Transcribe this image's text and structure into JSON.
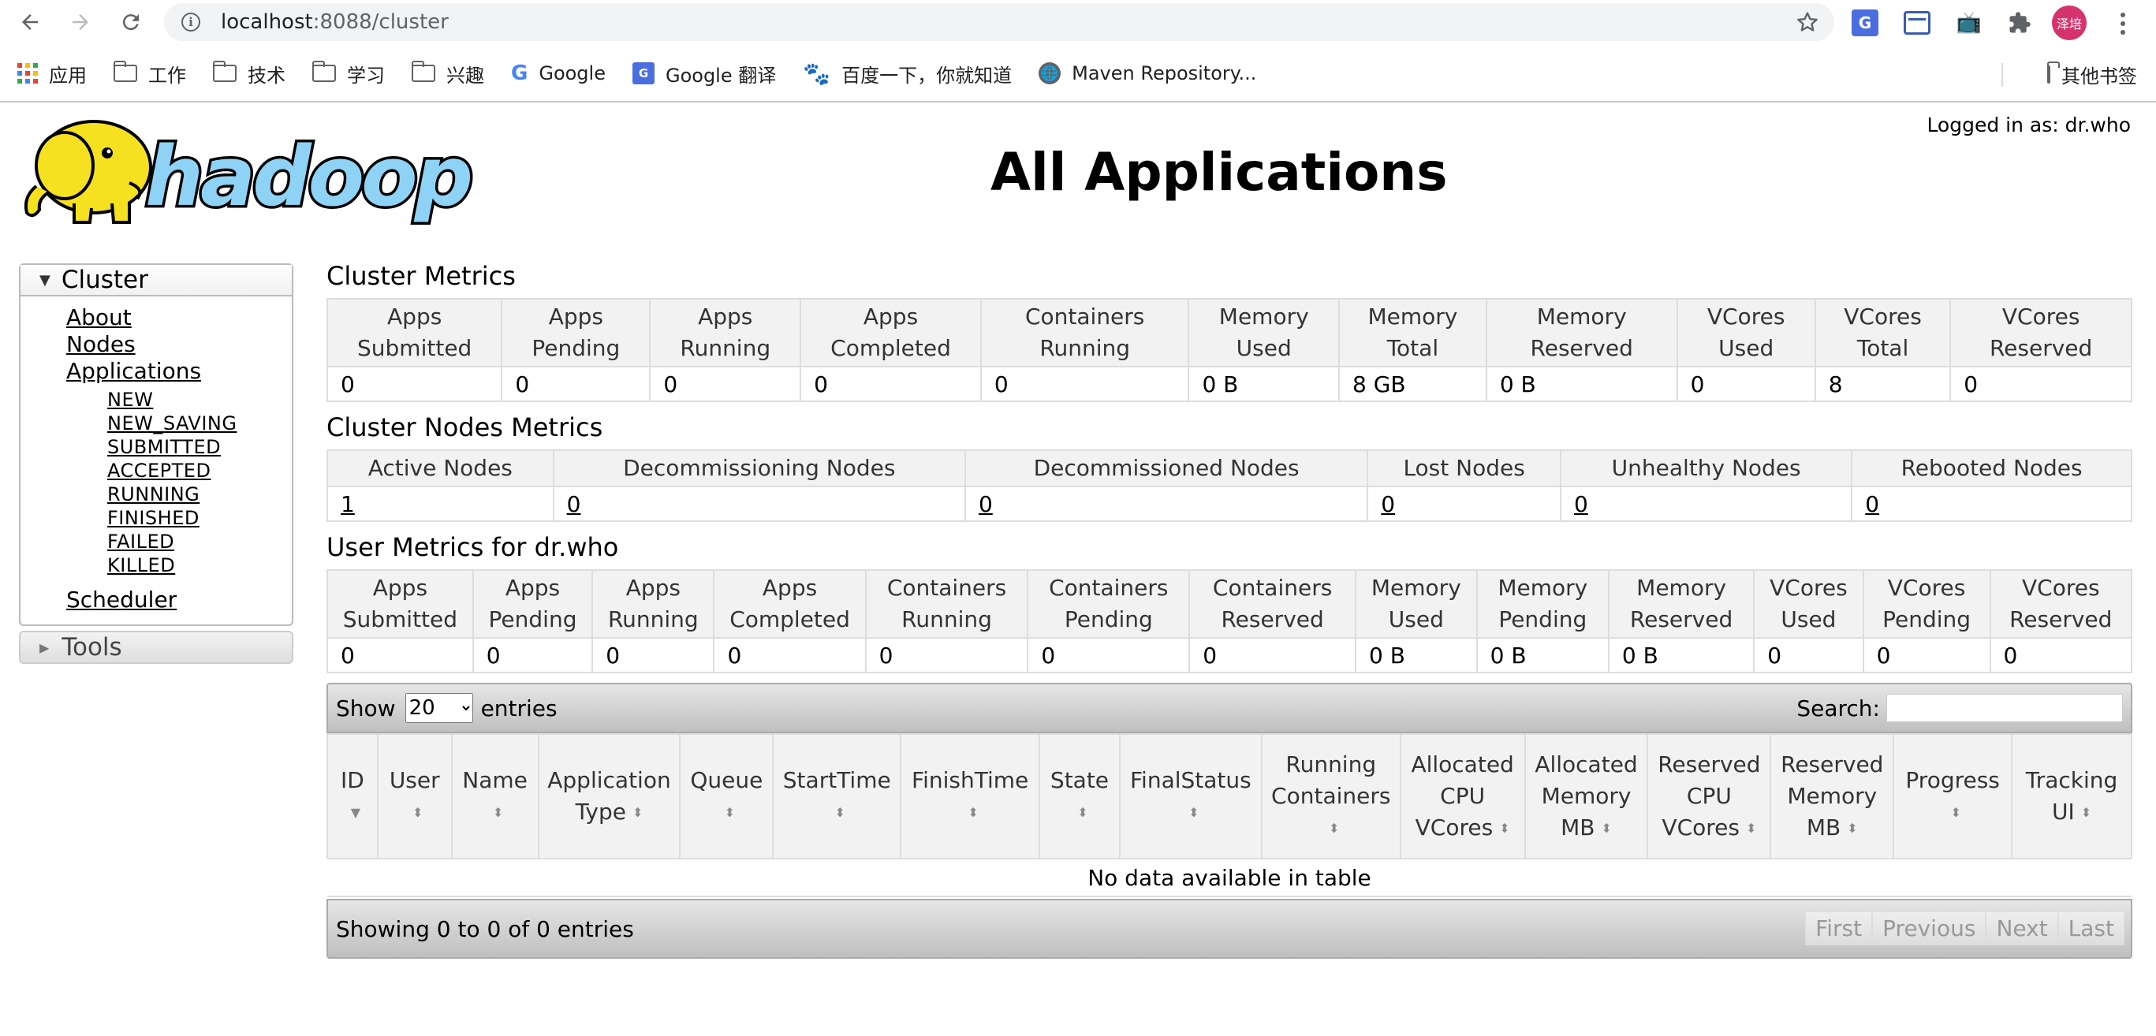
{
  "browser": {
    "url_host": "localhost",
    "url_path": ":8088/cluster",
    "profile_text": "泽培",
    "bookmarks": [
      {
        "label": "应用",
        "icon": "apps-icon"
      },
      {
        "label": "工作",
        "icon": "folder-icon"
      },
      {
        "label": "技术",
        "icon": "folder-icon"
      },
      {
        "label": "学习",
        "icon": "folder-icon"
      },
      {
        "label": "兴趣",
        "icon": "folder-icon"
      },
      {
        "label": "Google",
        "icon": "google-icon"
      },
      {
        "label": "Google 翻译",
        "icon": "google-translate-icon"
      },
      {
        "label": "百度一下，你就知道",
        "icon": "baidu-icon"
      },
      {
        "label": "Maven Repository...",
        "icon": "globe-icon"
      }
    ],
    "other_bookmarks": "其他书签"
  },
  "header": {
    "title": "All Applications",
    "logged_in": "Logged in as: dr.who"
  },
  "nav": {
    "cluster_label": "Cluster",
    "links": [
      "About",
      "Nodes",
      "Applications"
    ],
    "app_states": [
      "NEW",
      "NEW_SAVING",
      "SUBMITTED",
      "ACCEPTED",
      "RUNNING",
      "FINISHED",
      "FAILED",
      "KILLED"
    ],
    "scheduler": "Scheduler",
    "tools_label": "Tools"
  },
  "cluster_metrics": {
    "title": "Cluster Metrics",
    "headers": [
      "Apps Submitted",
      "Apps Pending",
      "Apps Running",
      "Apps Completed",
      "Containers Running",
      "Memory Used",
      "Memory Total",
      "Memory Reserved",
      "VCores Used",
      "VCores Total",
      "VCores Reserved"
    ],
    "values": [
      "0",
      "0",
      "0",
      "0",
      "0",
      "0 B",
      "8 GB",
      "0 B",
      "0",
      "8",
      "0"
    ]
  },
  "cluster_nodes_metrics": {
    "title": "Cluster Nodes Metrics",
    "headers": [
      "Active Nodes",
      "Decommissioning Nodes",
      "Decommissioned Nodes",
      "Lost Nodes",
      "Unhealthy Nodes",
      "Rebooted Nodes"
    ],
    "values": [
      "1",
      "0",
      "0",
      "0",
      "0",
      "0"
    ]
  },
  "user_metrics": {
    "title": "User Metrics for dr.who",
    "headers": [
      "Apps Submitted",
      "Apps Pending",
      "Apps Running",
      "Apps Completed",
      "Containers Running",
      "Containers Pending",
      "Containers Reserved",
      "Memory Used",
      "Memory Pending",
      "Memory Reserved",
      "VCores Used",
      "VCores Pending",
      "VCores Reserved"
    ],
    "values": [
      "0",
      "0",
      "0",
      "0",
      "0",
      "0",
      "0",
      "0 B",
      "0 B",
      "0 B",
      "0",
      "0",
      "0"
    ]
  },
  "apps_table": {
    "show_label": "Show",
    "entries_label": "entries",
    "page_size": "20",
    "search_label": "Search:",
    "columns": [
      "ID",
      "User",
      "Name",
      "Application Type",
      "Queue",
      "StartTime",
      "FinishTime",
      "State",
      "FinalStatus",
      "Running Containers",
      "Allocated CPU VCores",
      "Allocated Memory MB",
      "Reserved CPU VCores",
      "Reserved Memory MB",
      "Progress",
      "Tracking UI"
    ],
    "empty_message": "No data available in table",
    "info": "Showing 0 to 0 of 0 entries",
    "pager": [
      "First",
      "Previous",
      "Next",
      "Last"
    ]
  }
}
